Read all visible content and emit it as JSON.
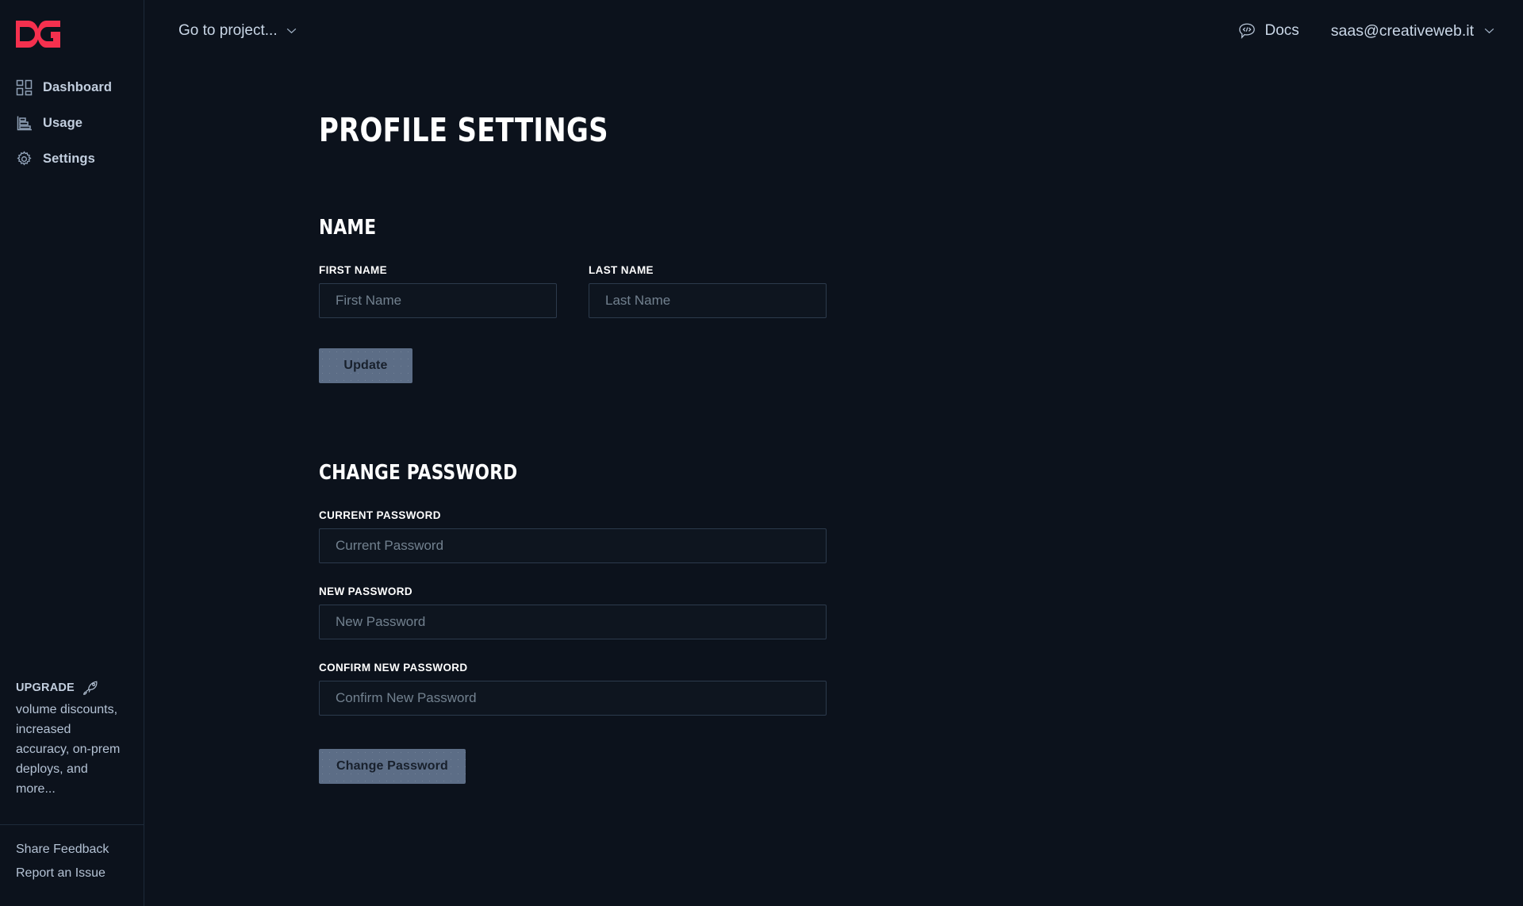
{
  "brand": {
    "logo_text": "DG",
    "logo_color": "#f5304e"
  },
  "sidebar": {
    "items": [
      {
        "label": "Dashboard",
        "icon": "dashboard-grid-icon"
      },
      {
        "label": "Usage",
        "icon": "bar-chart-icon"
      },
      {
        "label": "Settings",
        "icon": "gear-icon"
      }
    ],
    "upgrade": {
      "title": "UPGRADE",
      "icon": "rocket-icon",
      "body": "volume discounts, increased accuracy, on-prem deploys, and more..."
    },
    "footer_links": [
      {
        "label": "Share Feedback"
      },
      {
        "label": "Report an Issue"
      }
    ]
  },
  "topbar": {
    "project_selector": {
      "label": "Go to project...",
      "icon": "chevron-down-icon"
    },
    "docs": {
      "label": "Docs",
      "icon": "code-bubble-icon"
    },
    "account": {
      "label": "saas@creativeweb.it",
      "icon": "chevron-down-icon"
    }
  },
  "page": {
    "title": "PROFILE SETTINGS",
    "sections": [
      {
        "title": "NAME",
        "fields": [
          {
            "label": "FIRST NAME",
            "placeholder": "First Name",
            "value": ""
          },
          {
            "label": "LAST NAME",
            "placeholder": "Last Name",
            "value": ""
          }
        ],
        "button": "Update"
      },
      {
        "title": "CHANGE PASSWORD",
        "fields": [
          {
            "label": "CURRENT PASSWORD",
            "placeholder": "Current Password",
            "value": ""
          },
          {
            "label": "NEW PASSWORD",
            "placeholder": "New Password",
            "value": ""
          },
          {
            "label": "CONFIRM NEW PASSWORD",
            "placeholder": "Confirm New Password",
            "value": ""
          }
        ],
        "button": "Change Password"
      }
    ]
  },
  "colors": {
    "background": "#0c121c",
    "accent": "#f5304e",
    "button": "#5c6d86",
    "border": "#2c3a4c",
    "text": "#c9d6e6"
  }
}
